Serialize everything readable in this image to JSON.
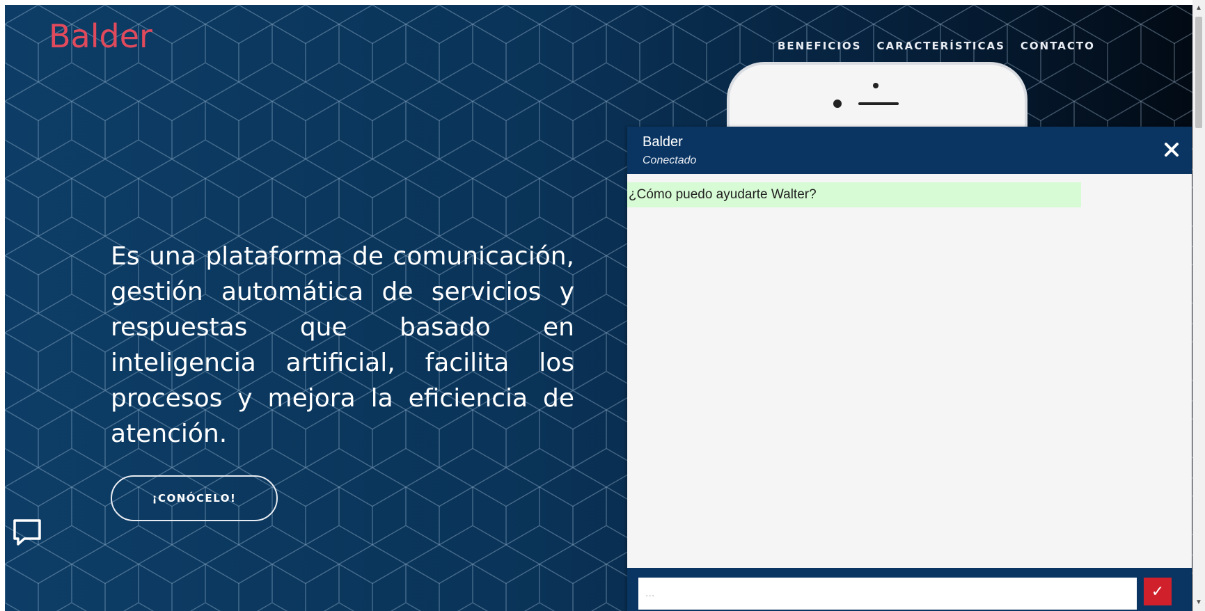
{
  "brand": {
    "name": "Balder",
    "color": "#e14a5c"
  },
  "nav": {
    "items": [
      {
        "label": "BENEFICIOS"
      },
      {
        "label": "CARACTERÍSTICAS"
      },
      {
        "label": "CONTACTO"
      }
    ]
  },
  "hero": {
    "description": "Es una plataforma de comunicación, gestión automática de servicios y respuestas que basado en inteligencia artificial, facilita los procesos y mejora la eficiencia de atención.",
    "cta_label": "¡CONÓCELO!",
    "background_color": "#0a3358"
  },
  "chat": {
    "title": "Balder",
    "status": "Conectado",
    "messages": [
      {
        "from": "bot",
        "text": "¿Cómo puedo ayudarte Walter?"
      }
    ],
    "input_placeholder": "...",
    "send_icon": "check-icon",
    "close_icon": "close-icon",
    "header_color": "#0a3563",
    "bot_bubble_color": "#d7fbd4",
    "send_color": "#d0202b"
  },
  "icons": {
    "chat_launcher": "chat-bubble-icon",
    "scroll_up": "chevron-up-icon",
    "scroll_down": "chevron-down-icon"
  }
}
